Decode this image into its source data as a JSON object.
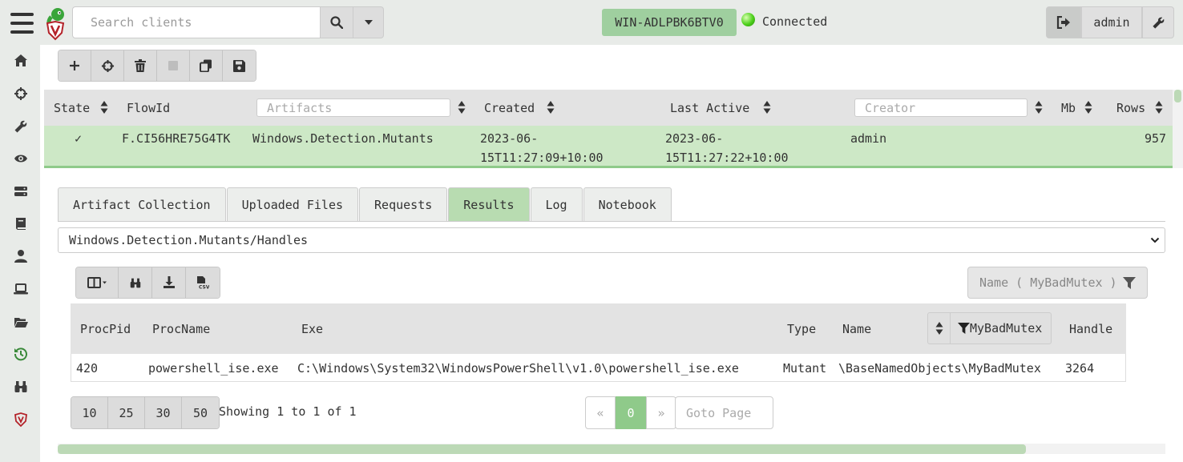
{
  "sidebar": {
    "items": [
      {
        "icon": "home-icon"
      },
      {
        "icon": "crosshairs-icon"
      },
      {
        "icon": "wrench-icon"
      },
      {
        "icon": "eye-icon"
      },
      {
        "icon": "server-icon"
      },
      {
        "icon": "book-icon"
      },
      {
        "icon": "user-icon"
      },
      {
        "icon": "laptop-icon"
      },
      {
        "icon": "folder-open-icon"
      },
      {
        "icon": "history-icon",
        "active": true
      },
      {
        "icon": "binoculars-icon"
      },
      {
        "icon": "velociraptor-shield-icon"
      }
    ]
  },
  "topbar": {
    "search_placeholder": "Search clients",
    "client_id": "WIN-ADLPBK6BTV0",
    "connection_status": "Connected",
    "username": "admin"
  },
  "flow_toolbar": {
    "buttons": [
      "plus-icon",
      "crosshairs-icon",
      "trash-icon",
      "stop-icon",
      "copy-icon",
      "save-icon"
    ]
  },
  "flows_table": {
    "headers": {
      "state": "State",
      "flow_id": "FlowId",
      "artifacts_placeholder": "Artifacts",
      "created": "Created",
      "last_active": "Last Active",
      "creator_placeholder": "Creator",
      "mb": "Mb",
      "rows": "Rows"
    },
    "row": {
      "state": "✓",
      "flow_id": "F.CI56HRE75G4TK",
      "artifact": "Windows.Detection.Mutants",
      "created_1": "2023-06-",
      "created_2": "15T11:27:09+10:00",
      "last_active_1": "2023-06-",
      "last_active_2": "15T11:27:22+10:00",
      "creator": "admin",
      "rows": "957"
    }
  },
  "tabs": [
    "Artifact Collection",
    "Uploaded Files",
    "Requests",
    "Results",
    "Log",
    "Notebook"
  ],
  "active_tab": "Results",
  "source_select": {
    "value": "Windows.Detection.Mutants/Handles"
  },
  "results": {
    "filter_label": "Name ( MyBadMutex )",
    "headers": {
      "proc_pid": "ProcPid",
      "proc_name": "ProcName",
      "exe": "Exe",
      "type": "Type",
      "name": "Name",
      "name_filter": "MyBadMutex",
      "handle": "Handle"
    },
    "rows": [
      {
        "proc_pid": "420",
        "proc_name": "powershell_ise.exe",
        "exe": "C:\\Windows\\System32\\WindowsPowerShell\\v1.0\\powershell_ise.exe",
        "type": "Mutant",
        "name": "\\BaseNamedObjects\\MyBadMutex",
        "handle": "3264"
      }
    ]
  },
  "pagination": {
    "page_sizes": [
      "10",
      "25",
      "30",
      "50"
    ],
    "showing": "Showing 1 to 1 of 1",
    "prev": "«",
    "current": "0",
    "next": "»",
    "goto_placeholder": "Goto Page"
  },
  "colors": {
    "accent_green": "#8fca8a",
    "selected_row": "#cde8c6",
    "client_badge": "#9fcf9f"
  }
}
